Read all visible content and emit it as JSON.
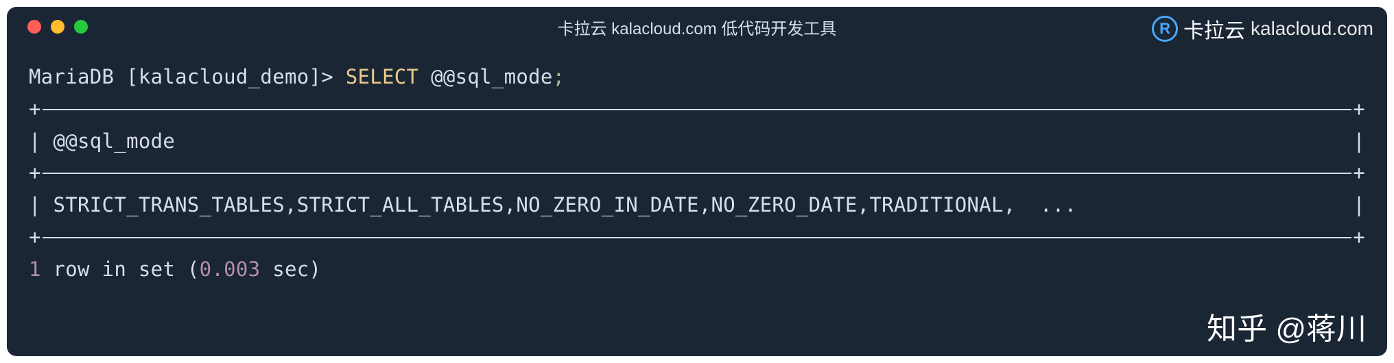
{
  "titlebar": {
    "title": "卡拉云 kalacloud.com 低代码开发工具"
  },
  "brand": {
    "logo_letter": "R",
    "name": "卡拉云",
    "domain": "kalacloud.com"
  },
  "prompt": {
    "db_label": "MariaDB [kalacloud_demo]> ",
    "keyword": "SELECT",
    "arg": " @@sql_mode",
    "semicolon": ";"
  },
  "table": {
    "header": "@@sql_mode",
    "row": "STRICT_TRANS_TABLES,STRICT_ALL_TABLES,NO_ZERO_IN_DATE,NO_ZERO_DATE,TRADITIONAL,  ..."
  },
  "result": {
    "count": "1",
    "mid": " row in set (",
    "time": "0.003",
    "tail": " sec)"
  },
  "zhihu": {
    "text": "知乎 @蒋川"
  }
}
